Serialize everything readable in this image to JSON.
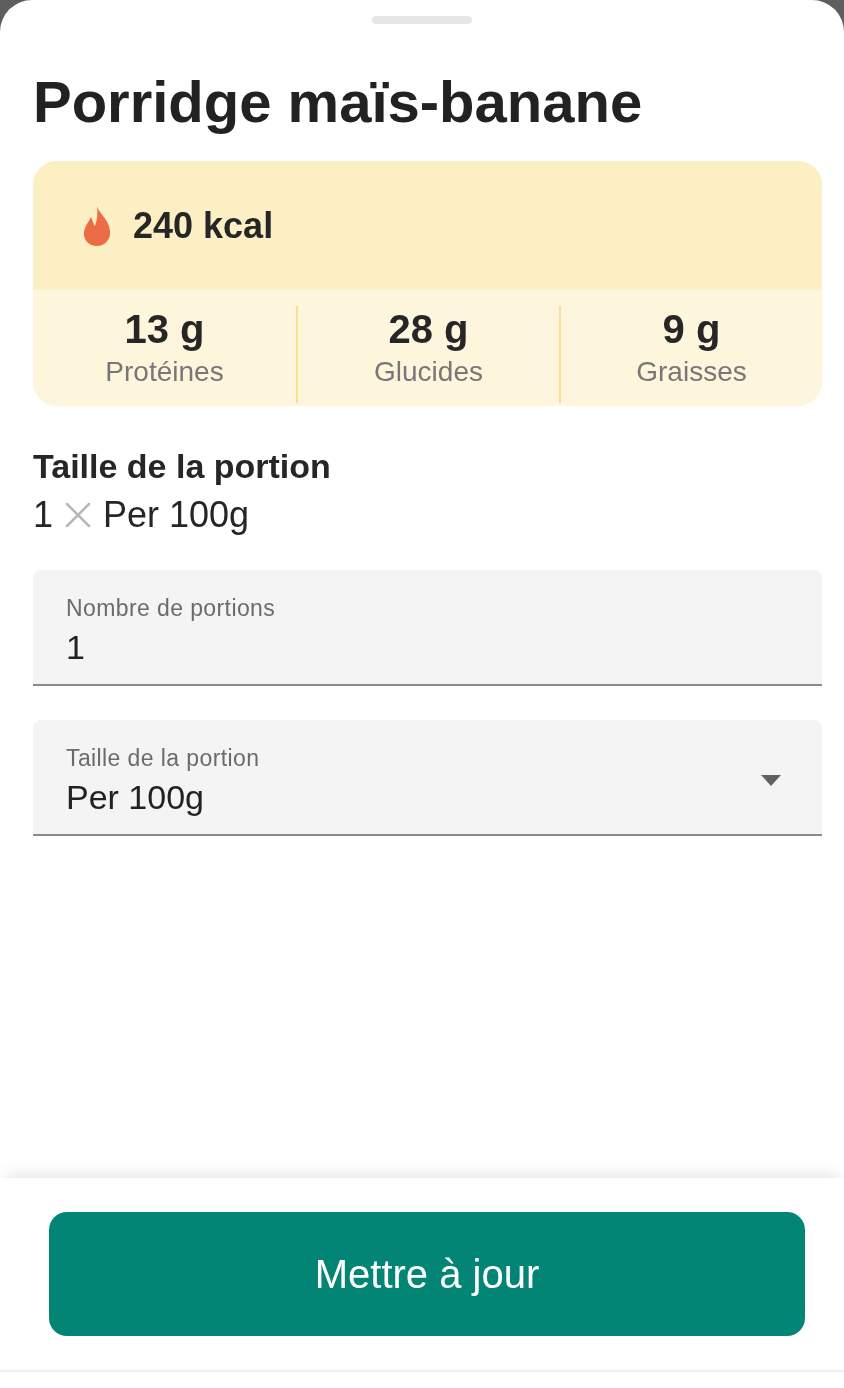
{
  "sheet": {
    "title": "Porridge maïs-banane"
  },
  "calories": {
    "value": "240 kcal"
  },
  "macros": [
    {
      "value": "13 g",
      "label": "Protéines"
    },
    {
      "value": "28 g",
      "label": "Glucides"
    },
    {
      "value": "9 g",
      "label": "Graisses"
    }
  ],
  "serving": {
    "heading": "Taille de la portion",
    "quantity": "1",
    "unit": "Per 100g"
  },
  "fields": [
    {
      "kind": "text",
      "label": "Nombre de portions",
      "value": "1"
    },
    {
      "kind": "select",
      "label": "Taille de la portion",
      "value": "Per 100g"
    }
  ],
  "primary_button": {
    "label": "Mettre à jour"
  }
}
